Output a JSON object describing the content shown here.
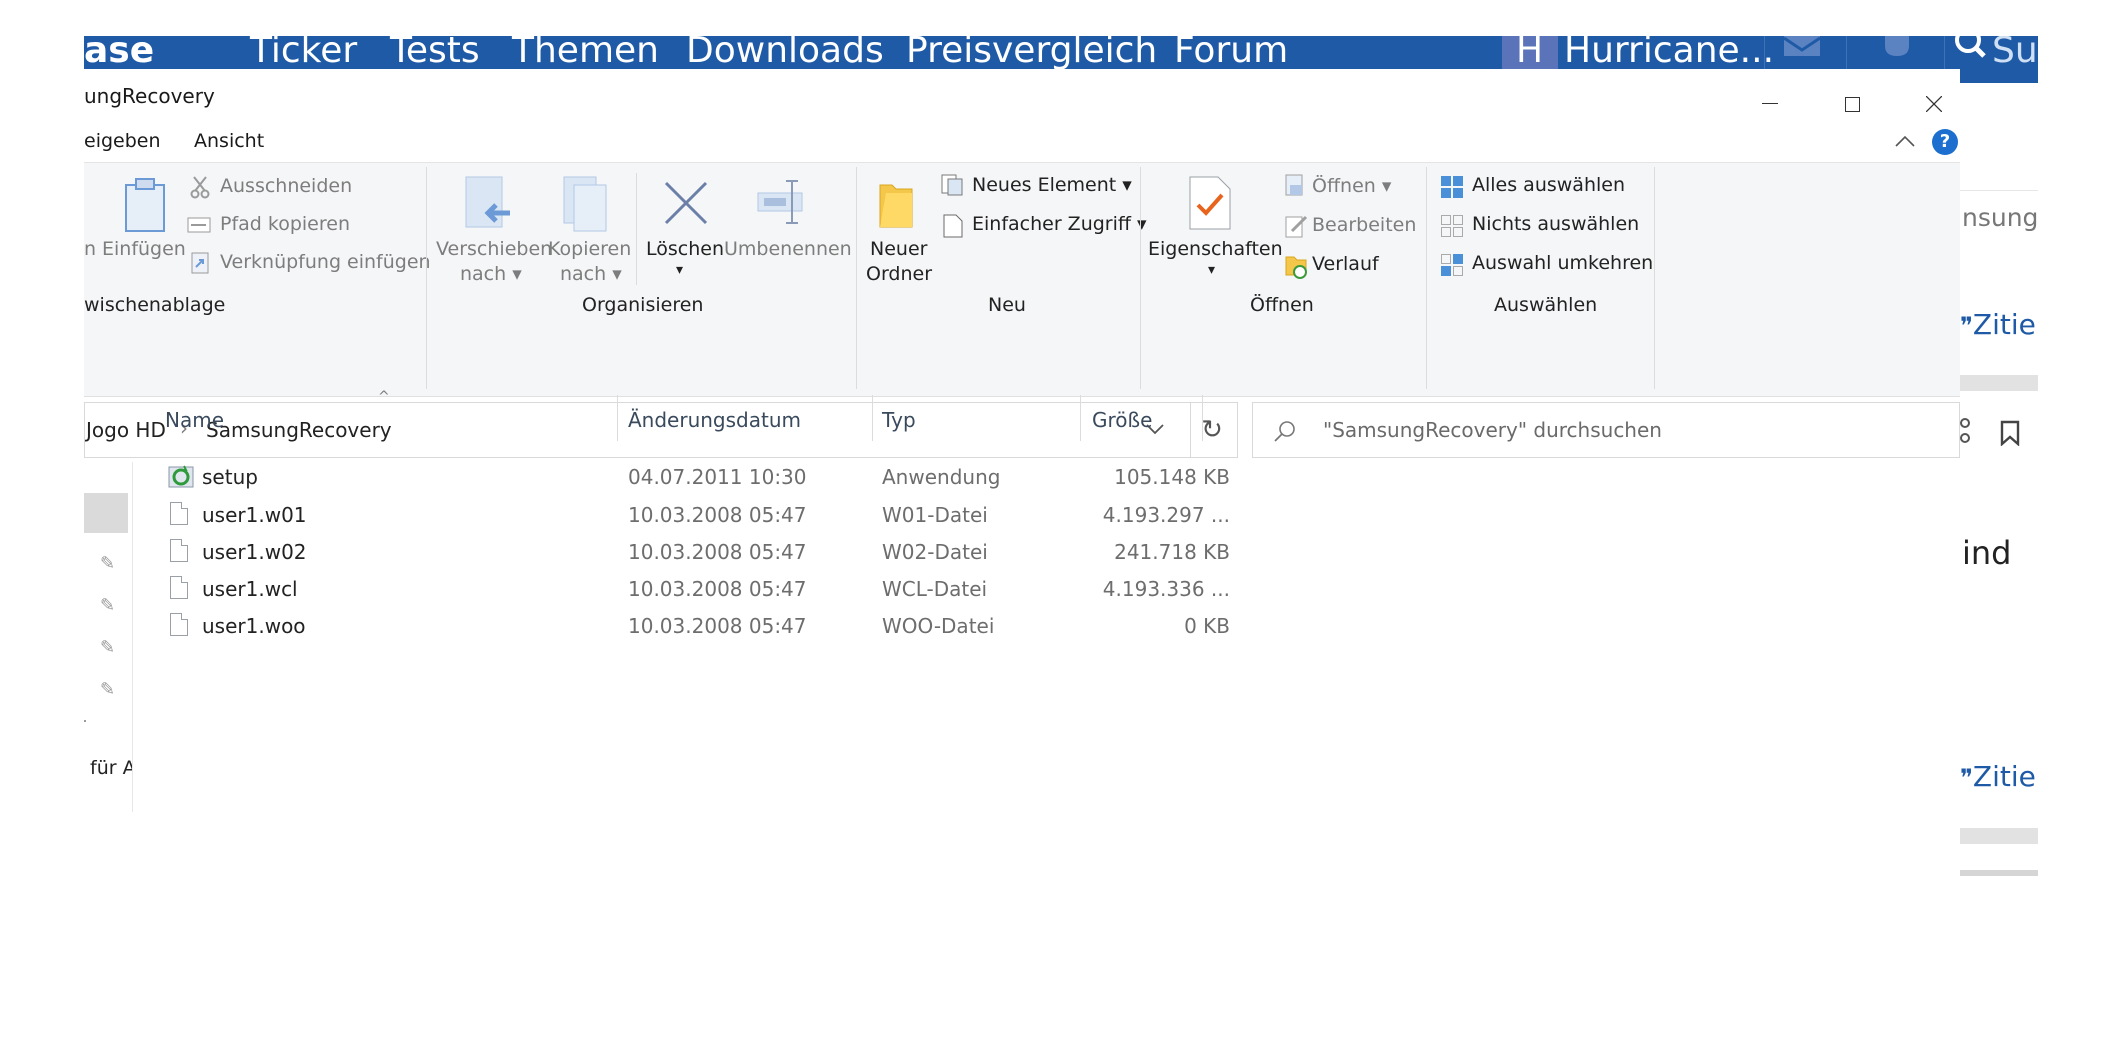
{
  "website": {
    "logo_fragment": "ase",
    "nav": [
      "Ticker",
      "Tests",
      "Themen",
      "Downloads",
      "Preisvergleich",
      "Forum"
    ],
    "user_initial": "H",
    "user_name": "Hurricane...",
    "search_fragment": "Su",
    "side_text_1": "nsung",
    "side_text_2": "Zitie",
    "side_text_3": "ind",
    "side_text_4": "Zitie"
  },
  "window": {
    "title": "ungRecovery",
    "controls": {
      "minimize": "–",
      "maximize": "☐",
      "close": "✕"
    }
  },
  "ribbon_tabs": [
    "eigeben",
    "Ansicht"
  ],
  "ribbon": {
    "clipboard": {
      "label": "wischenablage",
      "paste_fragment": "n",
      "paste": "Einfügen",
      "cut": "Ausschneiden",
      "copy_path": "Pfad kopieren",
      "paste_shortcut": "Verknüpfung einfügen"
    },
    "organize": {
      "label": "Organisieren",
      "move_to": [
        "Verschieben",
        "nach"
      ],
      "copy_to": [
        "Kopieren",
        "nach"
      ],
      "delete": "Löschen",
      "rename": "Umbenennen"
    },
    "new": {
      "label": "Neu",
      "new_folder": [
        "Neuer",
        "Ordner"
      ],
      "new_item": "Neues Element",
      "easy_access": "Einfacher Zugriff"
    },
    "open": {
      "label": "Öffnen",
      "properties": "Eigenschaften",
      "open": "Öffnen",
      "edit": "Bearbeiten",
      "history": "Verlauf"
    },
    "select": {
      "label": "Auswählen",
      "select_all": "Alles auswählen",
      "select_none": "Nichts auswählen",
      "invert": "Auswahl umkehren"
    }
  },
  "address": {
    "crumbs": [
      "Jogo HD",
      "SamsungRecovery"
    ],
    "search_placeholder": "\"SamsungRecovery\" durchsuchen"
  },
  "nav_pane": {
    "bottom_text": "für A"
  },
  "columns": [
    "Name",
    "Änderungsdatum",
    "Typ",
    "Größe"
  ],
  "files": [
    {
      "name": "setup",
      "date": "04.07.2011 10:30",
      "type": "Anwendung",
      "size": "105.148 KB",
      "icon": "setup-app-icon"
    },
    {
      "name": "user1.w01",
      "date": "10.03.2008 05:47",
      "type": "W01-Datei",
      "size": "4.193.297 ...",
      "icon": "file-icon"
    },
    {
      "name": "user1.w02",
      "date": "10.03.2008 05:47",
      "type": "W02-Datei",
      "size": "241.718 KB",
      "icon": "file-icon"
    },
    {
      "name": "user1.wcl",
      "date": "10.03.2008 05:47",
      "type": "WCL-Datei",
      "size": "4.193.336 ...",
      "icon": "file-icon"
    },
    {
      "name": "user1.woo",
      "date": "10.03.2008 05:47",
      "type": "WOO-Datei",
      "size": "0 KB",
      "icon": "file-icon"
    }
  ],
  "colors": {
    "site_blue": "#1f5aa6",
    "ribbon_bg": "#f5f6f7",
    "help_blue": "#1c6fcf"
  }
}
